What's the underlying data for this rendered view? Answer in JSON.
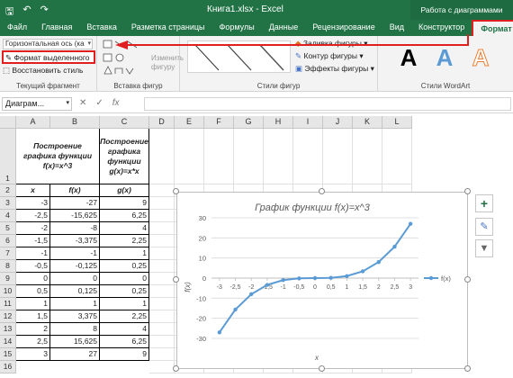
{
  "app": {
    "window_title": "Книга1.xlsx - Excel",
    "context_title": "Работа с диаграммами"
  },
  "tabs": [
    "Файл",
    "Главная",
    "Вставка",
    "Разметка страницы",
    "Формулы",
    "Данные",
    "Рецензирование",
    "Вид",
    "Конструктор",
    "Формат"
  ],
  "ribbon": {
    "current_fragment": {
      "combo_value": "Горизонтальная ось (ка",
      "format_selection": "Формат выделенного",
      "reset_style": "Восстановить стиль",
      "label": "Текущий фрагмент"
    },
    "insert_shapes": {
      "edit_shape": "Изменить фигуру",
      "label": "Вставка фигур"
    },
    "shape_styles": {
      "fill": "Заливка фигуры",
      "outline": "Контур фигуры",
      "effects": "Эффекты фигуры",
      "label": "Стили фигур"
    },
    "wordart": {
      "sample": "A",
      "label": "Стили WordArt"
    }
  },
  "formula_bar": {
    "name_box": "Диаграм...",
    "cancel": "✕",
    "enter": "✓",
    "fx": "fx"
  },
  "columns": [
    "A",
    "B",
    "C",
    "D",
    "E",
    "F",
    "G",
    "H",
    "I",
    "J",
    "K",
    "L"
  ],
  "rows": [
    "1",
    "2",
    "3",
    "4",
    "5",
    "6",
    "7",
    "8",
    "9",
    "10",
    "11",
    "12",
    "13",
    "14",
    "15",
    "16"
  ],
  "sheet": {
    "header_a": "Построение графика функции f(x)=x^3",
    "header_c": "Построение графика функции g(x)=x*x",
    "col_x": "x",
    "col_fx": "f(x)",
    "col_gx": "g(x)",
    "data": [
      [
        "-3",
        "-27",
        "9"
      ],
      [
        "-2,5",
        "-15,625",
        "6,25"
      ],
      [
        "-2",
        "-8",
        "4"
      ],
      [
        "-1,5",
        "-3,375",
        "2,25"
      ],
      [
        "-1",
        "-1",
        "1"
      ],
      [
        "-0,5",
        "-0,125",
        "0,25"
      ],
      [
        "0",
        "0",
        "0"
      ],
      [
        "0,5",
        "0,125",
        "0,25"
      ],
      [
        "1",
        "1",
        "1"
      ],
      [
        "1,5",
        "3,375",
        "2,25"
      ],
      [
        "2",
        "8",
        "4"
      ],
      [
        "2,5",
        "15,625",
        "6,25"
      ],
      [
        "3",
        "27",
        "9"
      ]
    ]
  },
  "chart_data": {
    "type": "line",
    "title": "График функции f(x)=x^3",
    "xlabel": "x",
    "ylabel": "f(x)",
    "x": [
      -3,
      -2.5,
      -2,
      -1.5,
      -1,
      -0.5,
      0,
      0.5,
      1,
      1.5,
      2,
      2.5,
      3
    ],
    "x_tick_labels": [
      "-3",
      "-2,5",
      "-2",
      "-1,5",
      "-1",
      "-0,5",
      "0",
      "0,5",
      "1",
      "1,5",
      "2",
      "2,5",
      "3"
    ],
    "series": [
      {
        "name": "f(x)",
        "values": [
          -27,
          -15.625,
          -8,
          -3.375,
          -1,
          -0.125,
          0,
          0.125,
          1,
          3.375,
          8,
          15.625,
          27
        ],
        "color": "#5b9bd5"
      }
    ],
    "y_ticks": [
      30,
      20,
      10,
      0,
      -10,
      -20,
      -30
    ],
    "ylim": [
      -30,
      30
    ],
    "grid": true,
    "legend": "right"
  },
  "side_buttons": {
    "add": "+",
    "style": "✎",
    "filter": "⏚"
  }
}
